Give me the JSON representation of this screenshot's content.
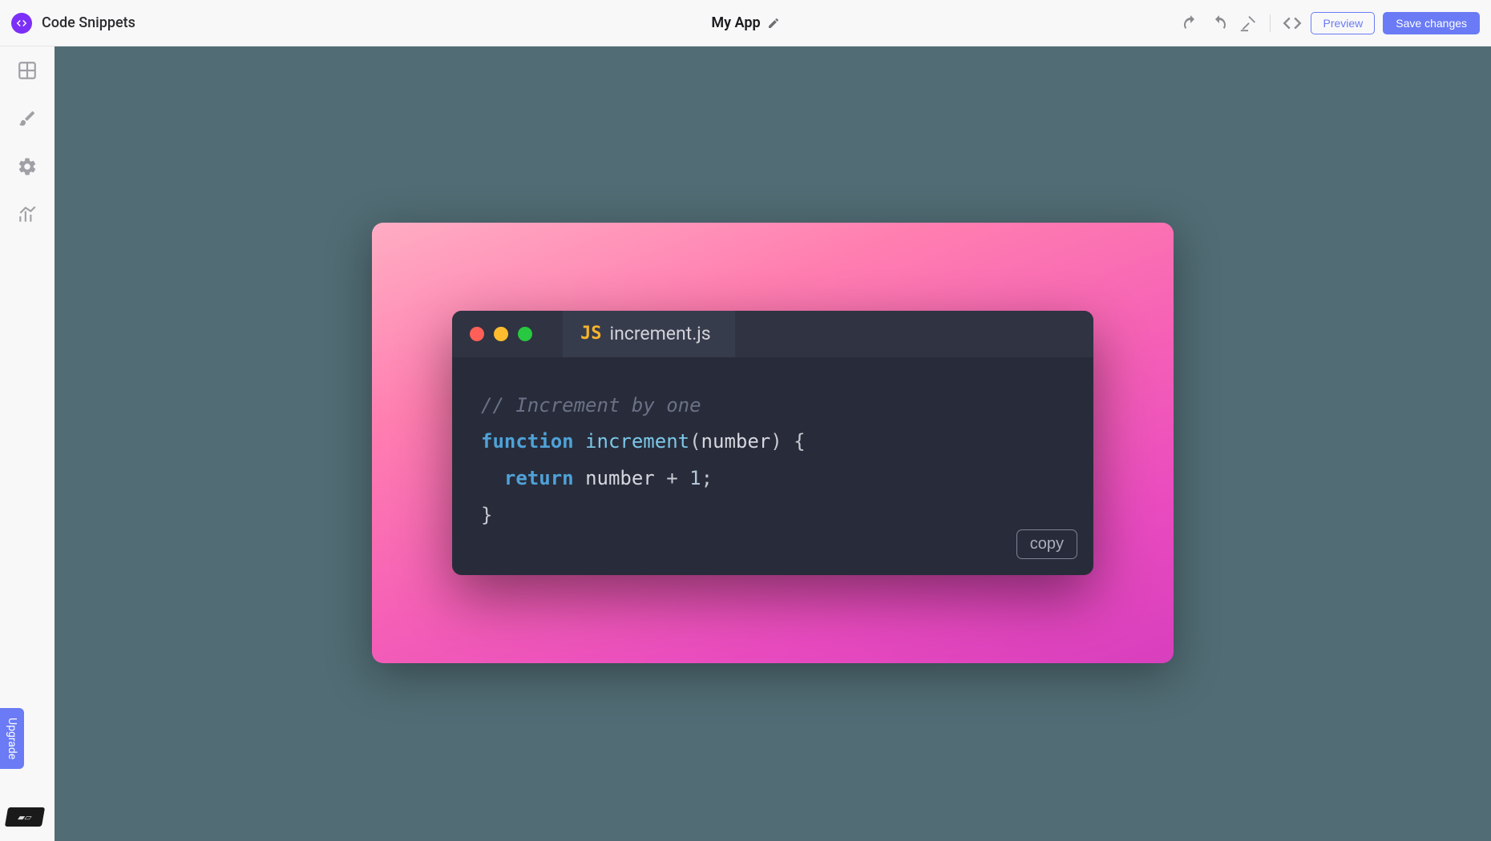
{
  "header": {
    "page_title": "Code Snippets",
    "app_name": "My App",
    "preview_label": "Preview",
    "save_label": "Save changes"
  },
  "sidebar": {
    "upgrade_label": "Upgrade"
  },
  "snippet": {
    "filename": "increment.js",
    "language_badge": "JS",
    "copy_label": "copy",
    "code": {
      "comment": "// Increment by one",
      "kw_function": "function ",
      "func_name": "increment",
      "open_paren": "(",
      "param": "number",
      "close_paren_brace": ") {",
      "indent_return": "  ",
      "kw_return": "return ",
      "expr_ident": "number",
      "expr_op": " + ",
      "expr_num": "1",
      "expr_semi": ";",
      "close_brace": "}"
    }
  },
  "colors": {
    "canvas_bg": "#516c74",
    "accent": "#6a7bf5",
    "gradient_start": "#ffadc3",
    "gradient_end": "#d83fbd",
    "code_bg": "#282c3a"
  }
}
